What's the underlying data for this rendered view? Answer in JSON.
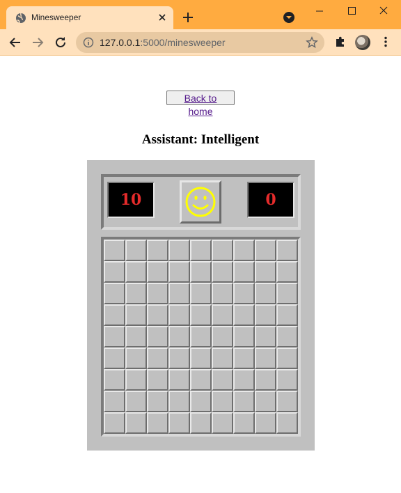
{
  "browser": {
    "tab_title": "Minesweeper",
    "url_host": "127.0.0.1",
    "url_rest": ":5000/minesweeper"
  },
  "page": {
    "back_button_label": "Back to home",
    "assistant_label": "Assistant: Intelligent"
  },
  "game": {
    "mine_counter": "10",
    "timer": "0",
    "face": "smiley",
    "rows": 9,
    "cols": 9,
    "colors": {
      "board": "#c0c0c0",
      "counter_digits": "#e52b2b",
      "counter_bg": "#000000",
      "face": "#ffff00",
      "chrome": "#ffab40"
    }
  }
}
